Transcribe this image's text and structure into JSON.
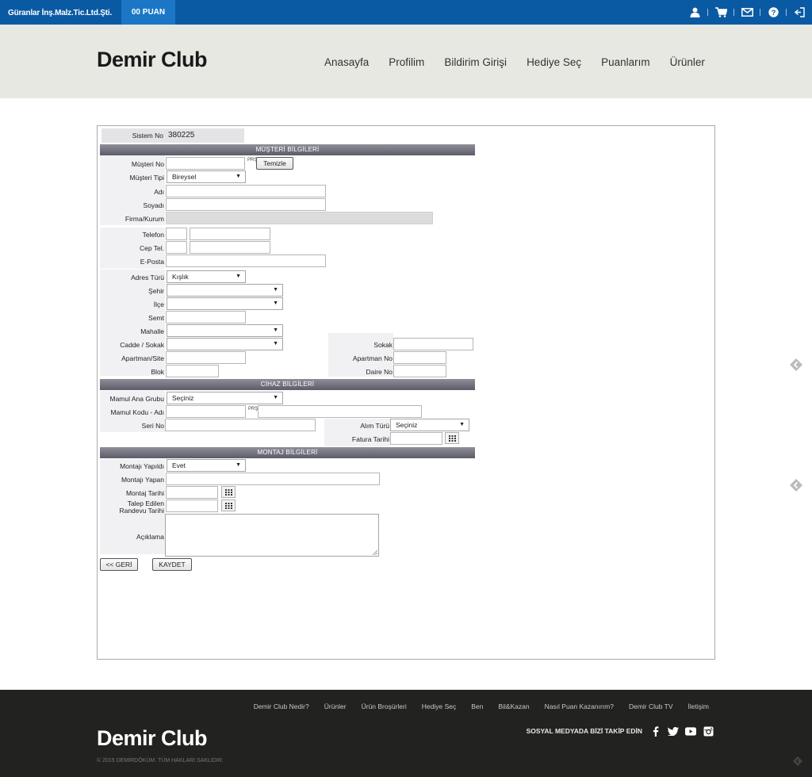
{
  "topbar": {
    "company": "Güranlar İnş.Malz.Tic.Ltd.Şti.",
    "points": "00 PUAN",
    "icons": [
      "user-icon",
      "cart-icon",
      "mail-icon",
      "help-icon",
      "logout-icon"
    ]
  },
  "header": {
    "logo": "Demir Club",
    "nav": [
      "Anasayfa",
      "Profilim",
      "Bildirim Girişi",
      "Hediye Seç",
      "Puanlarım",
      "Ürünler"
    ]
  },
  "form": {
    "system_no_label": "Sistem No",
    "system_no_value": "380225",
    "customer_section": "MÜŞTERİ BİLGİLERİ",
    "customer_no_label": "Müşteri No",
    "clear_button": "Temizle",
    "customer_type_label": "Müşteri Tipi",
    "customer_type_value": "Bireysel",
    "name_label": "Adı",
    "surname_label": "Soyadı",
    "company_label": "Firma/Kurum",
    "phone_label": "Telefon",
    "mobile_label": "Cep Tel.",
    "email_label": "E-Posta",
    "address_type_label": "Adres Türü",
    "address_type_value": "Kışlık",
    "city_label": "Şehir",
    "district_label": "İlçe",
    "area_label": "Semt",
    "neighborhood_label": "Mahalle",
    "street_label": "Cadde / Sokak",
    "lane_label": "Sokak",
    "apartment_label": "Apartman/Site",
    "apartment_no_label": "Apartman No",
    "block_label": "Blok",
    "flat_no_label": "Daire No",
    "device_section": "CİHAZ BİLGİLERİ",
    "product_group_label": "Mamul Ana Grubu",
    "product_group_value": "Seçiniz",
    "product_code_label": "Mamul Kodu - Adı",
    "serial_no_label": "Seri No",
    "purchase_type_label": "Alım Türü",
    "purchase_type_value": "Seçiniz",
    "invoice_date_label": "Fatura Tarihi",
    "install_section": "MONTAJ BİLGİLERİ",
    "installed_label": "Montajı Yapıldı",
    "installed_value": "Evet",
    "installer_label": "Montajı Yapan",
    "install_date_label": "Montaj Tarihi",
    "appointment_label_1": "Talep Edilen",
    "appointment_label_2": "Randevu Tarihi",
    "description_label": "Açıklama",
    "back_button": "<< GERİ",
    "save_button": "KAYDET",
    "picker_text": "PRŞ"
  },
  "footer": {
    "links": [
      "Demir Club Nedir?",
      "Ürünler",
      "Ürün Broşürleri",
      "Hediye Seç",
      "Ben",
      "Bil&Kazan",
      "Nasıl Puan Kazanırım?",
      "Demir Club TV",
      "İletişim"
    ],
    "logo": "Demir Club",
    "copyright": "© 2015 DEMİRDÖKÜM. TÜM HAKLARI SAKLIDIR.",
    "social_text": "SOSYAL MEDYADA BİZİ TAKİP EDİN",
    "social_icons": [
      "facebook-icon",
      "twitter-icon",
      "youtube-icon",
      "instagram-icon"
    ]
  }
}
